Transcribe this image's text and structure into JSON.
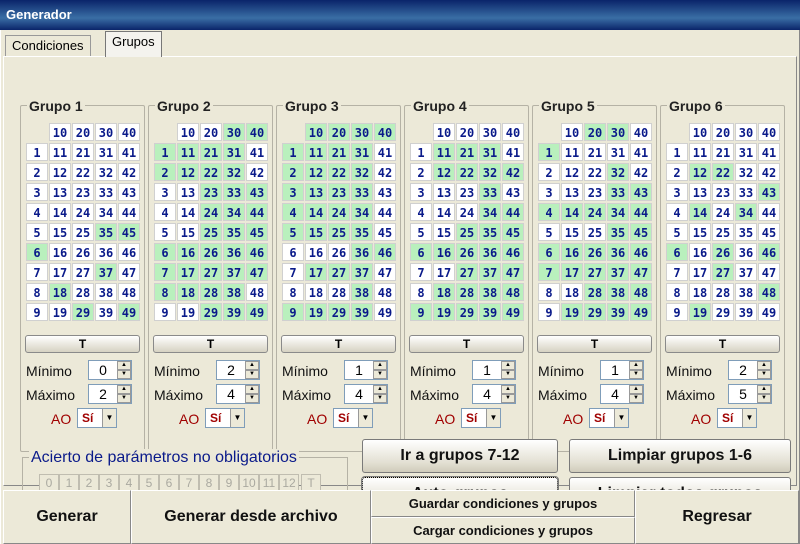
{
  "window": {
    "title": "Generador"
  },
  "tabs": [
    {
      "label": "Condiciones"
    },
    {
      "label": "Grupos"
    }
  ],
  "header_row": [
    "10",
    "20",
    "30",
    "40"
  ],
  "numbers": [
    [
      "1",
      "11",
      "21",
      "31",
      "41"
    ],
    [
      "2",
      "12",
      "22",
      "32",
      "42"
    ],
    [
      "3",
      "13",
      "23",
      "33",
      "43"
    ],
    [
      "4",
      "14",
      "24",
      "34",
      "44"
    ],
    [
      "5",
      "15",
      "25",
      "35",
      "45"
    ],
    [
      "6",
      "16",
      "26",
      "36",
      "46"
    ],
    [
      "7",
      "17",
      "27",
      "37",
      "47"
    ],
    [
      "8",
      "18",
      "28",
      "38",
      "48"
    ],
    [
      "9",
      "19",
      "29",
      "39",
      "49"
    ]
  ],
  "groups": [
    {
      "title": "Grupo 1",
      "t_label": "T",
      "min_label": "Mínimo",
      "min": "0",
      "max_label": "Máximo",
      "max": "2",
      "ao_label": "AO",
      "ao_value": "Sí",
      "header_sel": [
        false,
        false,
        false,
        false
      ],
      "sel": [
        [
          0,
          0,
          0,
          0,
          0
        ],
        [
          0,
          0,
          0,
          0,
          0
        ],
        [
          0,
          0,
          0,
          0,
          0
        ],
        [
          0,
          0,
          0,
          0,
          0
        ],
        [
          0,
          0,
          0,
          1,
          1
        ],
        [
          1,
          0,
          0,
          0,
          0
        ],
        [
          0,
          0,
          0,
          1,
          0
        ],
        [
          0,
          1,
          0,
          0,
          0
        ],
        [
          0,
          0,
          1,
          0,
          1
        ]
      ]
    },
    {
      "title": "Grupo 2",
      "t_label": "T",
      "min_label": "Mínimo",
      "min": "2",
      "max_label": "Máximo",
      "max": "4",
      "ao_label": "AO",
      "ao_value": "Sí",
      "header_sel": [
        false,
        false,
        true,
        true
      ],
      "sel": [
        [
          1,
          1,
          1,
          1,
          0
        ],
        [
          1,
          1,
          1,
          1,
          0
        ],
        [
          0,
          0,
          1,
          1,
          1
        ],
        [
          0,
          0,
          1,
          1,
          1
        ],
        [
          0,
          0,
          1,
          1,
          1
        ],
        [
          1,
          1,
          1,
          1,
          1
        ],
        [
          1,
          1,
          1,
          1,
          1
        ],
        [
          1,
          1,
          1,
          1,
          0
        ],
        [
          0,
          0,
          1,
          1,
          1
        ]
      ]
    },
    {
      "title": "Grupo 3",
      "t_label": "T",
      "min_label": "Mínimo",
      "min": "1",
      "max_label": "Máximo",
      "max": "4",
      "ao_label": "AO",
      "ao_value": "Sí",
      "header_sel": [
        true,
        true,
        true,
        true
      ],
      "sel": [
        [
          1,
          1,
          1,
          1,
          0
        ],
        [
          1,
          1,
          1,
          1,
          0
        ],
        [
          1,
          1,
          1,
          1,
          0
        ],
        [
          1,
          1,
          1,
          1,
          0
        ],
        [
          1,
          1,
          1,
          1,
          0
        ],
        [
          0,
          0,
          0,
          1,
          1
        ],
        [
          0,
          1,
          1,
          1,
          0
        ],
        [
          0,
          0,
          0,
          1,
          0
        ],
        [
          1,
          1,
          1,
          1,
          0
        ]
      ]
    },
    {
      "title": "Grupo 4",
      "t_label": "T",
      "min_label": "Mínimo",
      "min": "1",
      "max_label": "Máximo",
      "max": "4",
      "ao_label": "AO",
      "ao_value": "Sí",
      "header_sel": [
        false,
        false,
        false,
        false
      ],
      "sel": [
        [
          0,
          1,
          1,
          1,
          0
        ],
        [
          0,
          1,
          1,
          1,
          1
        ],
        [
          0,
          0,
          0,
          1,
          0
        ],
        [
          0,
          0,
          0,
          1,
          1
        ],
        [
          0,
          0,
          1,
          1,
          1
        ],
        [
          1,
          1,
          1,
          1,
          1
        ],
        [
          0,
          0,
          1,
          1,
          1
        ],
        [
          0,
          1,
          1,
          1,
          1
        ],
        [
          1,
          1,
          1,
          1,
          1
        ]
      ]
    },
    {
      "title": "Grupo 5",
      "t_label": "T",
      "min_label": "Mínimo",
      "min": "1",
      "max_label": "Máximo",
      "max": "4",
      "ao_label": "AO",
      "ao_value": "Sí",
      "header_sel": [
        false,
        true,
        true,
        false
      ],
      "sel": [
        [
          1,
          0,
          0,
          0,
          0
        ],
        [
          0,
          0,
          0,
          1,
          0
        ],
        [
          0,
          0,
          0,
          1,
          1
        ],
        [
          1,
          1,
          1,
          1,
          1
        ],
        [
          0,
          0,
          0,
          1,
          1
        ],
        [
          1,
          1,
          1,
          1,
          1
        ],
        [
          1,
          1,
          1,
          1,
          1
        ],
        [
          0,
          0,
          1,
          1,
          1
        ],
        [
          0,
          1,
          1,
          1,
          1
        ]
      ]
    },
    {
      "title": "Grupo 6",
      "t_label": "T",
      "min_label": "Mínimo",
      "min": "2",
      "max_label": "Máximo",
      "max": "5",
      "ao_label": "AO",
      "ao_value": "Sí",
      "header_sel": [
        false,
        false,
        false,
        false
      ],
      "sel": [
        [
          0,
          0,
          0,
          0,
          0
        ],
        [
          0,
          1,
          1,
          0,
          0
        ],
        [
          0,
          0,
          0,
          0,
          1
        ],
        [
          0,
          1,
          0,
          1,
          0
        ],
        [
          0,
          0,
          0,
          0,
          0
        ],
        [
          1,
          0,
          1,
          0,
          1
        ],
        [
          0,
          0,
          1,
          0,
          0
        ],
        [
          0,
          0,
          0,
          0,
          1
        ],
        [
          0,
          1,
          0,
          0,
          0
        ]
      ]
    }
  ],
  "acierto": {
    "title": "Acierto de parámetros no obligatorios",
    "buttons": [
      "0",
      "1",
      "2",
      "3",
      "4",
      "5",
      "6",
      "7",
      "8",
      "9",
      "10",
      "11",
      "12"
    ],
    "t_label": "T"
  },
  "actions": {
    "ir_grupos": "Ir a grupos 7-12",
    "auto_grupos": "Auto-grupos",
    "limpiar_1_6": "Limpiar grupos 1-6",
    "limpiar_todos": "Limpiar todos grupos"
  },
  "bottom": {
    "generar": "Generar",
    "generar_archivo": "Generar desde archivo",
    "guardar": "Guardar condiciones y grupos",
    "cargar": "Cargar condiciones y grupos",
    "regresar": "Regresar"
  },
  "colors": {
    "selected": "#b9f0bd",
    "number_text": "#0a1a8a",
    "ao_text": "#a00000"
  }
}
